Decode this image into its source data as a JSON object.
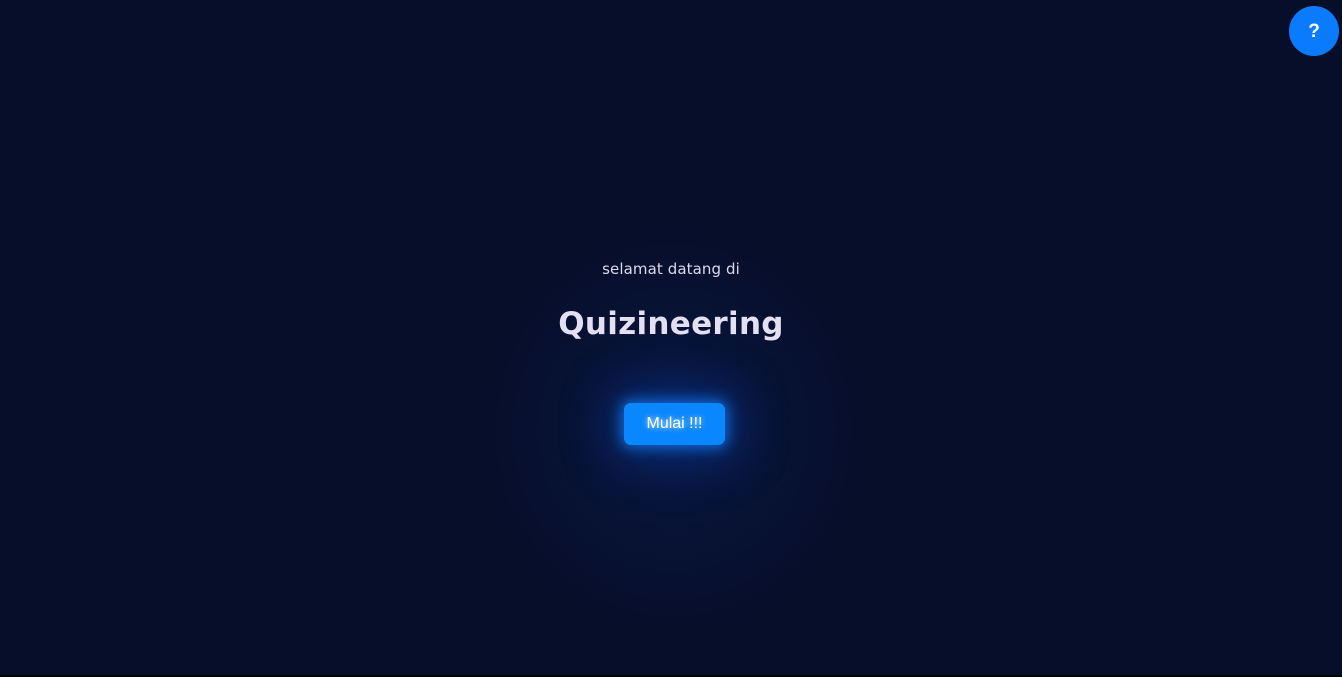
{
  "help": {
    "label": "?",
    "color": "#0a7bff"
  },
  "hero": {
    "welcome_text": "selamat datang di",
    "title": "Quizineering",
    "start_label": "Mulai !!!",
    "accent_color": "#0a86ff"
  },
  "theme": {
    "background": "#070e2a",
    "text": "#e2e0f2"
  }
}
